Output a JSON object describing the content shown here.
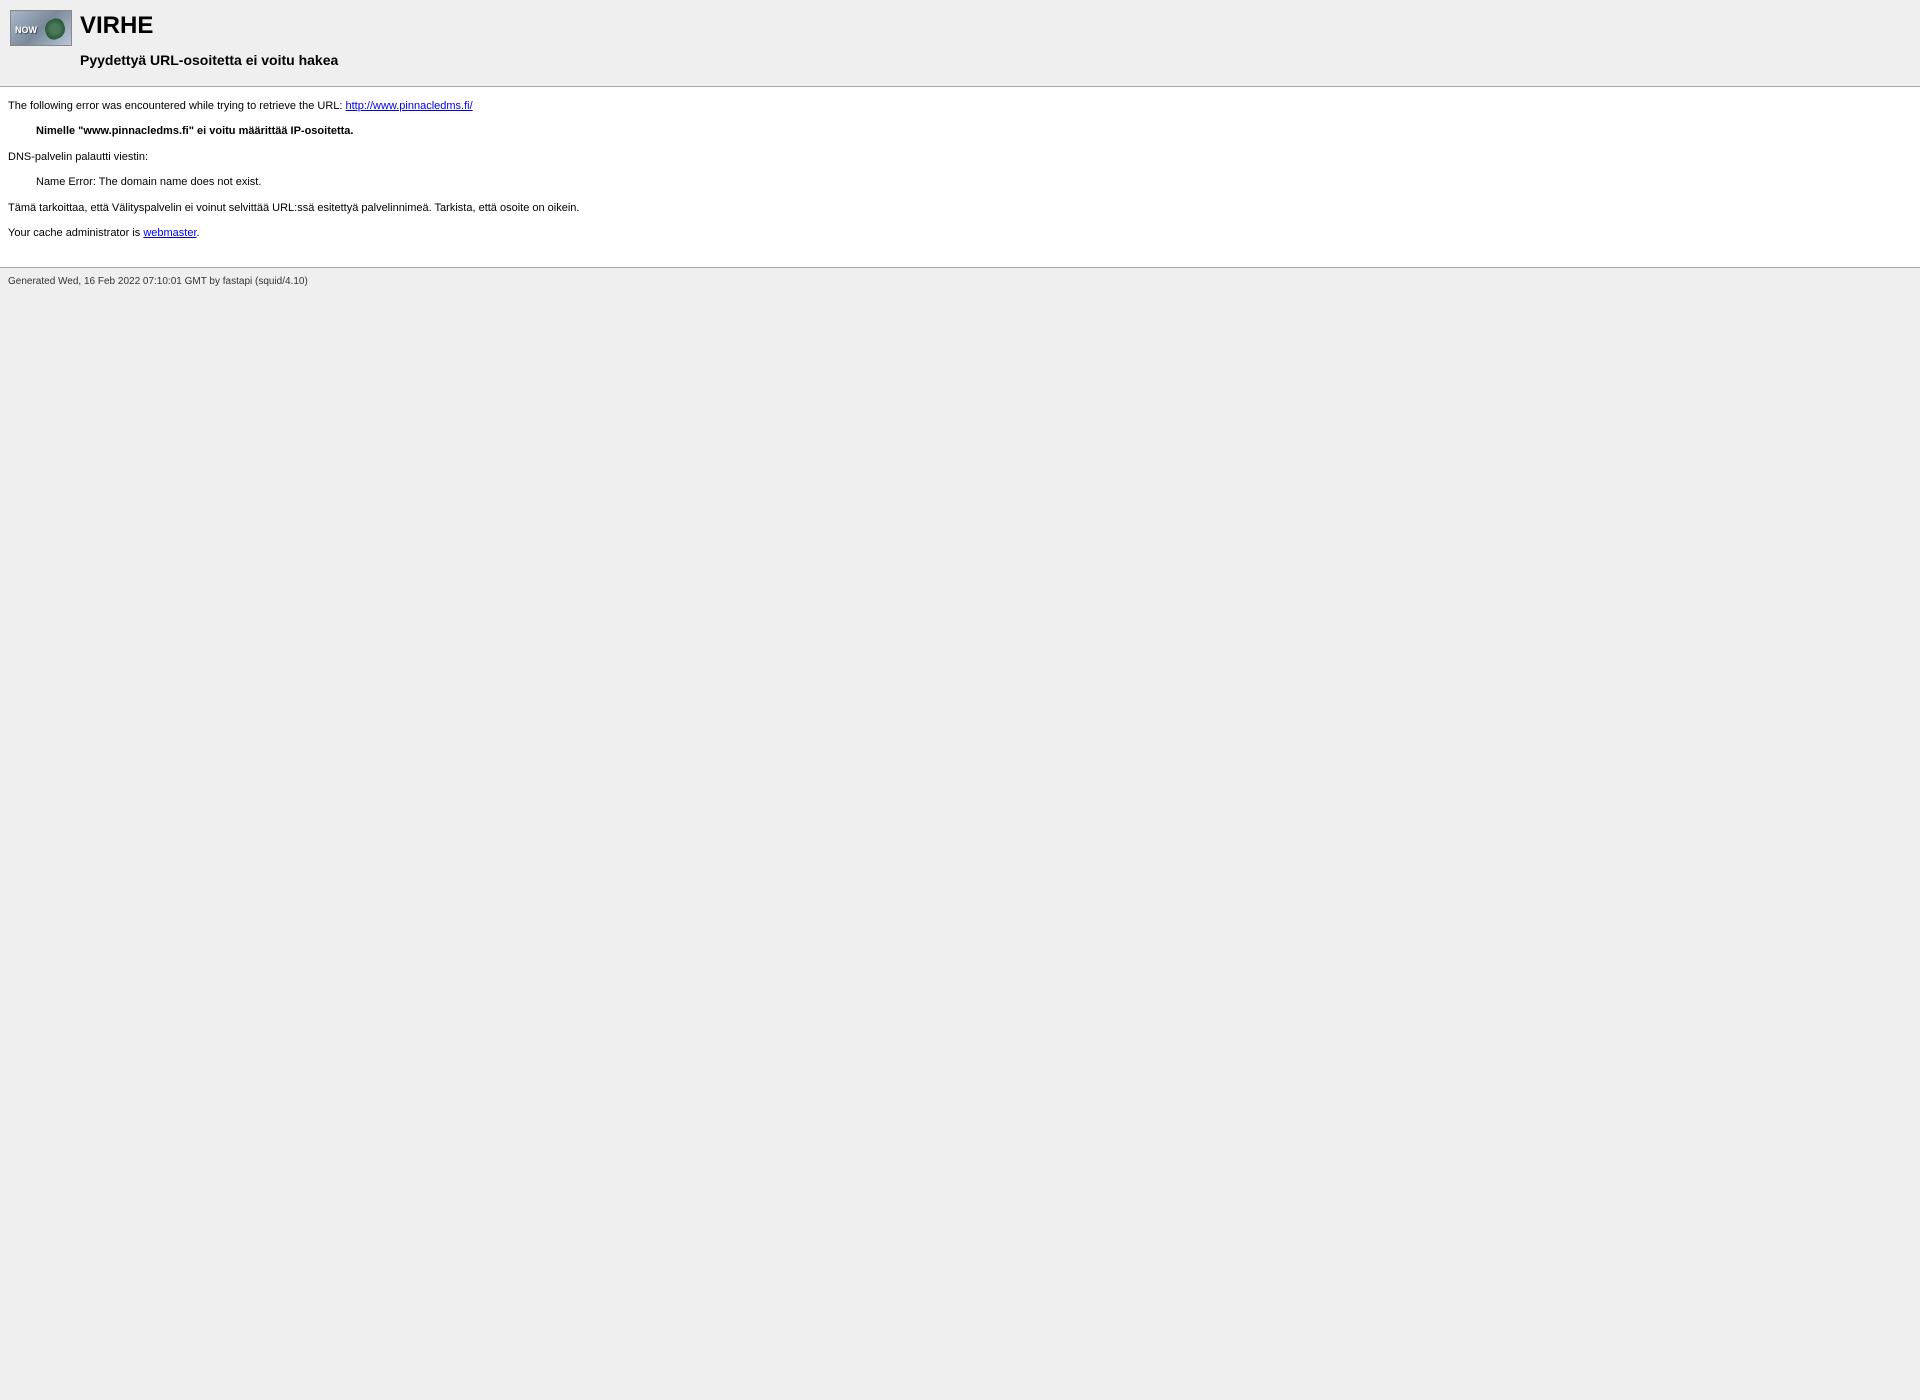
{
  "header": {
    "title": "VIRHE",
    "subtitle": "Pyydettyä URL-osoitetta ei voitu hakea"
  },
  "content": {
    "intro_text": "The following error was encountered while trying to retrieve the URL: ",
    "url": "http://www.pinnacledms.fi/",
    "error_bold": "Nimelle \"www.pinnacledms.fi\" ei voitu määrittää IP-osoitetta.",
    "dns_text": "DNS-palvelin palautti viestin:",
    "dns_error": "Name Error: The domain name does not exist.",
    "explanation": "Tämä tarkoittaa, että Välityspalvelin ei voinut selvittää URL:ssä esitettyä palvelinnimeä. Tarkista, että osoite on oikein.",
    "admin_text": "Your cache administrator is ",
    "admin_link": "webmaster",
    "admin_suffix": "."
  },
  "footer": {
    "generated": "Generated Wed, 16 Feb 2022 07:10:01 GMT by fastapi (squid/4.10)"
  }
}
